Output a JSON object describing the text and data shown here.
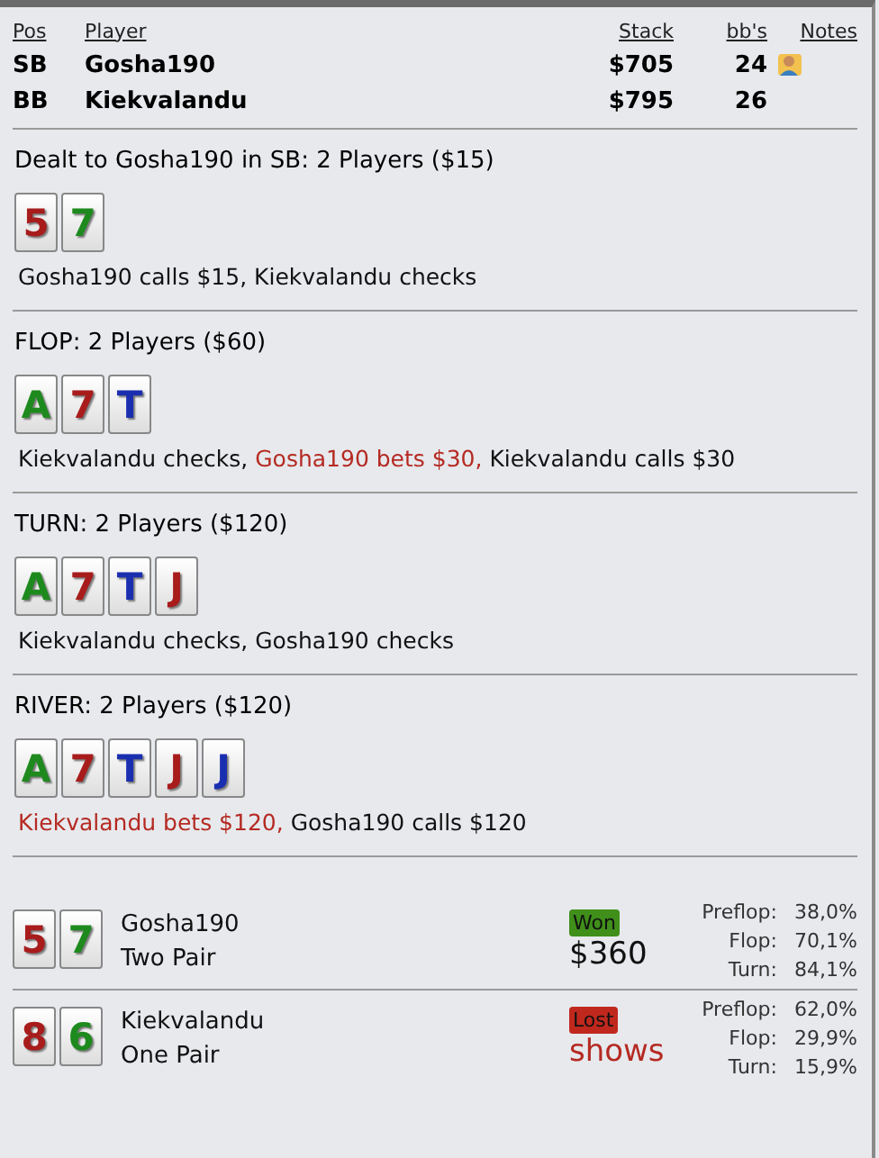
{
  "columns": [
    "Pos",
    "Player",
    "Stack",
    "bb's",
    "Notes"
  ],
  "players": [
    {
      "pos": "SB",
      "name": "Gosha190",
      "stack": "$705",
      "bbs": "24",
      "has_note": true
    },
    {
      "pos": "BB",
      "name": "Kiekvalandu",
      "stack": "$795",
      "bbs": "26",
      "has_note": false
    }
  ],
  "streets": [
    {
      "title": "Dealt to Gosha190 in SB: 2 Players ($15)",
      "cards": [
        {
          "rank": "5",
          "color": "#a81c1c"
        },
        {
          "rank": "7",
          "color": "#1e8a1e"
        }
      ],
      "actions": [
        {
          "text": "Gosha190 calls $15, Kiekvalandu checks",
          "aggressive": false
        }
      ]
    },
    {
      "title": "FLOP: 2 Players ($60)",
      "cards": [
        {
          "rank": "A",
          "color": "#1e8a1e"
        },
        {
          "rank": "7",
          "color": "#a81c1c"
        },
        {
          "rank": "T",
          "color": "#1a2fb0"
        }
      ],
      "actions": [
        {
          "text": "Kiekvalandu checks, ",
          "aggressive": false
        },
        {
          "text": "Gosha190 bets $30,",
          "aggressive": true
        },
        {
          "text": " Kiekvalandu calls $30",
          "aggressive": false
        }
      ]
    },
    {
      "title": "TURN: 2 Players ($120)",
      "cards": [
        {
          "rank": "A",
          "color": "#1e8a1e"
        },
        {
          "rank": "7",
          "color": "#a81c1c"
        },
        {
          "rank": "T",
          "color": "#1a2fb0"
        },
        {
          "rank": "J",
          "color": "#a81c1c"
        }
      ],
      "actions": [
        {
          "text": "Kiekvalandu checks, Gosha190 checks",
          "aggressive": false
        }
      ]
    },
    {
      "title": "RIVER: 2 Players ($120)",
      "cards": [
        {
          "rank": "A",
          "color": "#1e8a1e"
        },
        {
          "rank": "7",
          "color": "#a81c1c"
        },
        {
          "rank": "T",
          "color": "#1a2fb0"
        },
        {
          "rank": "J",
          "color": "#a81c1c"
        },
        {
          "rank": "J",
          "color": "#1a2fb0"
        }
      ],
      "actions": [
        {
          "text": "Kiekvalandu bets $120,",
          "aggressive": true
        },
        {
          "text": " Gosha190 calls $120",
          "aggressive": false
        }
      ]
    }
  ],
  "results": [
    {
      "cards": [
        {
          "rank": "5",
          "color": "#a81c1c"
        },
        {
          "rank": "7",
          "color": "#1e8a1e"
        }
      ],
      "name": "Gosha190",
      "hand": "Two Pair",
      "won": true,
      "badge": "Won",
      "amount": "$360",
      "equity": [
        {
          "label": "Preflop:",
          "value": "38,0%"
        },
        {
          "label": "Flop:",
          "value": "70,1%"
        },
        {
          "label": "Turn:",
          "value": "84,1%"
        }
      ]
    },
    {
      "cards": [
        {
          "rank": "8",
          "color": "#a81c1c"
        },
        {
          "rank": "6",
          "color": "#1e8a1e"
        }
      ],
      "name": "Kiekvalandu",
      "hand": "One Pair",
      "won": false,
      "badge": "Lost",
      "amount": "shows",
      "equity": [
        {
          "label": "Preflop:",
          "value": "62,0%"
        },
        {
          "label": "Flop:",
          "value": "29,9%"
        },
        {
          "label": "Turn:",
          "value": "15,9%"
        }
      ]
    }
  ]
}
